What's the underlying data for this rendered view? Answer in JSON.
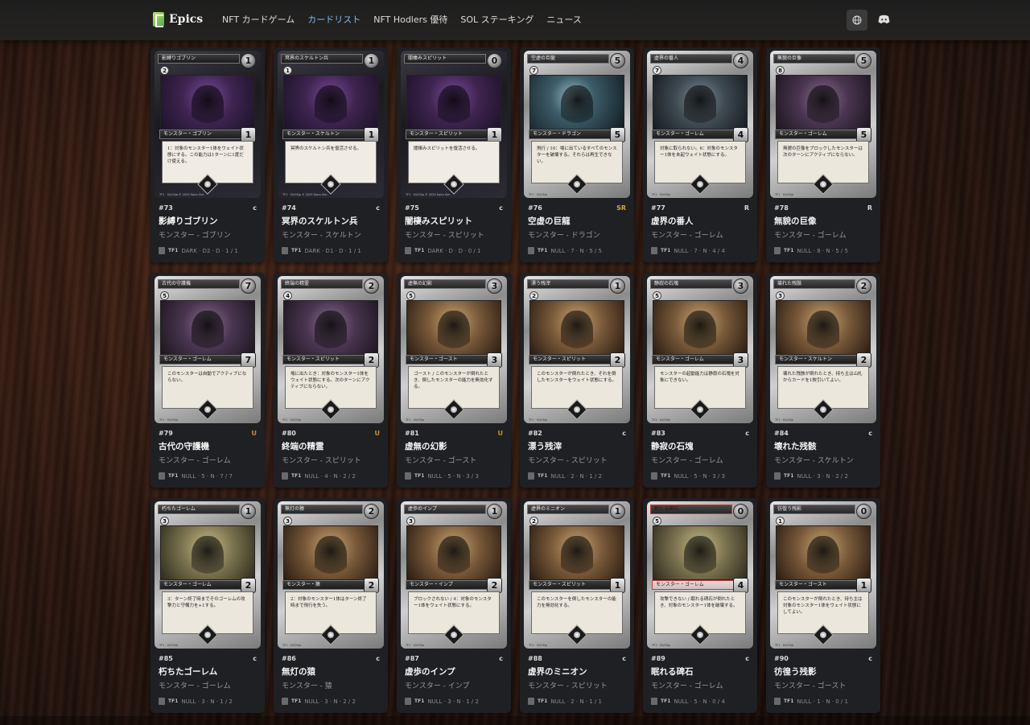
{
  "nav": {
    "brand": "Epics",
    "links": [
      "NFT カードゲーム",
      "カードリスト",
      "NFT Hodlers 優待",
      "SOL ステーキング",
      "ニュース"
    ],
    "active_index": 1
  },
  "colors": {
    "active_link": "#7fb7ef",
    "rarity_c": "#d6d6d6",
    "rarity_r": "#d6d6d6",
    "rarity_u": "#c98a2a",
    "rarity_sr": "#d6a53a"
  },
  "cards": [
    {
      "card_name": "影縛りゴブリン",
      "cost": "1",
      "level": "2",
      "type_line": "モンスター・ゴブリン",
      "power": "1",
      "text": "1：対象のモンスター1体をウェイト状態にする。この能力は1ターンに1度だけ使える。",
      "footer": "TF1 · 02/05ja   © 2025 Epics Sim",
      "num": "#73",
      "rarity": "C",
      "name": "影縛りゴブリン",
      "type": "モンスター - ゴブリン",
      "set": "TF1",
      "stats": "DARK · D2 · D · 1 / 1",
      "frame": "dark",
      "art": "purple"
    },
    {
      "card_name": "冥界のスケルトン兵",
      "cost": "1",
      "level": "1",
      "type_line": "モンスター・スケルトン",
      "power": "1",
      "text": "冥界のスケルトン兵を復活させる。",
      "footer": "TF1 · 02/05ja   © 2025 Epics Sim",
      "num": "#74",
      "rarity": "C",
      "name": "冥界のスケルトン兵",
      "type": "モンスター - スケルトン",
      "set": "TF1",
      "stats": "DARK · D1 · D · 1 / 1",
      "frame": "dark",
      "art": "purple"
    },
    {
      "card_name": "闇棲みスピリット",
      "cost": "0",
      "level": "",
      "type_line": "モンスター・スピリット",
      "power": "1",
      "text": "闇棲みスピリットを復活させる。",
      "footer": "TF1 · 02/05ja   © 2025 Epics Sim",
      "num": "#75",
      "rarity": "C",
      "name": "闇棲みスピリット",
      "type": "モンスター - スピリット",
      "set": "TF1",
      "stats": "DARK · D · D · 0 / 1",
      "frame": "dark",
      "art": "purple"
    },
    {
      "card_name": "空虚の巨龍",
      "cost": "5",
      "level": "7",
      "type_line": "モンスター・ドラゴン",
      "power": "5",
      "text": "飛行 / 10：場に出ているすべてのモンスターを破壊する。それらは再生できない。",
      "footer": "TF1 · 02/05ja",
      "num": "#76",
      "rarity": "SR",
      "name": "空虚の巨龍",
      "type": "モンスター - ドラゴン",
      "set": "TF1",
      "stats": "NULL · 7 · N · 5 / 5",
      "frame": "silver",
      "art": "teal"
    },
    {
      "card_name": "虚界の番人",
      "cost": "4",
      "level": "7",
      "type_line": "モンスター・ゴーレム",
      "power": "4",
      "text": "対象に取られない。6：対象のモンスター1体を未起ウェイト状態にする。",
      "footer": "TF1 · 02/05ja",
      "num": "#77",
      "rarity": "R",
      "name": "虚界の番人",
      "type": "モンスター - ゴーレム",
      "set": "TF1",
      "stats": "NULL · 7 · N · 4 / 4",
      "frame": "silver",
      "art": "steel"
    },
    {
      "card_name": "無貌の巨像",
      "cost": "5",
      "level": "8",
      "type_line": "モンスター・ゴーレム",
      "power": "5",
      "text": "無貌の巨像をブロックしたモンスターは次のターンにアクティブにならない。",
      "footer": "TF1 · 02/05ja",
      "num": "#78",
      "rarity": "R",
      "name": "無貌の巨像",
      "type": "モンスター - ゴーレム",
      "set": "TF1",
      "stats": "NULL · 8 · N · 5 / 5",
      "frame": "silver",
      "art": "violet"
    },
    {
      "card_name": "古代の守護機",
      "cost": "7",
      "level": "5",
      "type_line": "モンスター・ゴーレム",
      "power": "7",
      "text": "このモンスターは自動でアクティブにならない。",
      "footer": "TF1 · 02/05ja",
      "num": "#79",
      "rarity": "U",
      "name": "古代の守護機",
      "type": "モンスター - ゴーレム",
      "set": "TF1",
      "stats": "NULL · 5 · N · 7 / 7",
      "frame": "silver",
      "art": "violet"
    },
    {
      "card_name": "終端の精霊",
      "cost": "2",
      "level": "4",
      "type_line": "モンスター・スピリット",
      "power": "2",
      "text": "場に出たとき：対象のモンスター1体をウェイト状態にする。次のターンにアクティブにならない。",
      "footer": "TF1 · 02/05ja",
      "num": "#80",
      "rarity": "U",
      "name": "終端の精霊",
      "type": "モンスター - スピリット",
      "set": "TF1",
      "stats": "NULL · 4 · N · 2 / 2",
      "frame": "silver",
      "art": "violet"
    },
    {
      "card_name": "虚無の幻影",
      "cost": "3",
      "level": "5",
      "type_line": "モンスター・ゴースト",
      "power": "3",
      "text": "ゴースト / このモンスターが倒れたとき、倒したモンスターの能力を無効化する。",
      "footer": "TF1 · 02/05ja",
      "num": "#81",
      "rarity": "U",
      "name": "虚無の幻影",
      "type": "モンスター - ゴースト",
      "set": "TF1",
      "stats": "NULL · 5 · N · 3 / 3",
      "frame": "silver",
      "art": "sepia"
    },
    {
      "card_name": "漂う残滓",
      "cost": "1",
      "level": "2",
      "type_line": "モンスター・スピリット",
      "power": "2",
      "text": "このモンスターが倒れたとき、それを倒したモンスターをウェイト状態にする。",
      "footer": "TF1 · 02/05ja",
      "num": "#82",
      "rarity": "C",
      "name": "漂う残滓",
      "type": "モンスター - スピリット",
      "set": "TF1",
      "stats": "NULL · 2 · N · 1 / 2",
      "frame": "silver",
      "art": "sepia"
    },
    {
      "card_name": "静寂の石塊",
      "cost": "3",
      "level": "5",
      "type_line": "モンスター・ゴーレム",
      "power": "3",
      "text": "モンスターの起動能力は静寂の石塊を対象にできない。",
      "footer": "TF1 · 02/05ja",
      "num": "#83",
      "rarity": "C",
      "name": "静寂の石塊",
      "type": "モンスター - ゴーレム",
      "set": "TF1",
      "stats": "NULL · 5 · N · 3 / 3",
      "frame": "silver",
      "art": "sepia"
    },
    {
      "card_name": "壊れた残骸",
      "cost": "2",
      "level": "3",
      "type_line": "モンスター・スケルトン",
      "power": "2",
      "text": "壊れた残骸が倒れたとき、持ち主は山札からカードを1枚引いてよい。",
      "footer": "TF1 · 02/05ja",
      "num": "#84",
      "rarity": "C",
      "name": "壊れた残骸",
      "type": "モンスター - スケルトン",
      "set": "TF1",
      "stats": "NULL · 3 · N · 2 / 2",
      "frame": "silver",
      "art": "sepia"
    },
    {
      "card_name": "朽ちたゴーレム",
      "cost": "1",
      "level": "3",
      "type_line": "モンスター・ゴーレム",
      "power": "2",
      "text": "3：ターン終了時までそのゴーレムの攻撃力と守備力を+1する。",
      "footer": "TF1 · 02/05ja",
      "num": "#85",
      "rarity": "C",
      "name": "朽ちたゴーレム",
      "type": "モンスター - ゴーレム",
      "set": "TF1",
      "stats": "NULL · 3 · N · 1 / 2",
      "frame": "silver",
      "art": "olive"
    },
    {
      "card_name": "無灯の猿",
      "cost": "2",
      "level": "3",
      "type_line": "モンスター・猿",
      "power": "2",
      "text": "2：対象のモンスター1体はターン終了時まで飛行を失う。",
      "footer": "TF1 · 02/05ja",
      "num": "#86",
      "rarity": "C",
      "name": "無灯の猿",
      "type": "モンスター - 猿",
      "set": "TF1",
      "stats": "NULL · 3 · N · 2 / 2",
      "frame": "silver",
      "art": "sepia"
    },
    {
      "card_name": "虚歩のインプ",
      "cost": "1",
      "level": "3",
      "type_line": "モンスター・インプ",
      "power": "2",
      "text": "ブロックされない / 4：対象のモンスター1体をウェイト状態にする。",
      "footer": "TF1 · 02/05ja",
      "num": "#87",
      "rarity": "C",
      "name": "虚歩のインプ",
      "type": "モンスター - インプ",
      "set": "TF1",
      "stats": "NULL · 3 · N · 1 / 2",
      "frame": "silver",
      "art": "sepia"
    },
    {
      "card_name": "虚界のミニオン",
      "cost": "1",
      "level": "2",
      "type_line": "モンスター・スピリット",
      "power": "1",
      "text": "このモンスターを倒したモンスターの能力を無効化する。",
      "footer": "TF1 · 02/05ja",
      "num": "#88",
      "rarity": "C",
      "name": "虚界のミニオン",
      "type": "モンスター - スピリット",
      "set": "TF1",
      "stats": "NULL · 2 · N · 1 / 1",
      "frame": "silver",
      "art": "sepia"
    },
    {
      "card_name": "眠れる碑石",
      "cost": "0",
      "level": "5",
      "type_line": "モンスター・ゴーレム",
      "power": "4",
      "text": "攻撃できない / 眠れる碑石が倒れたとき、対象のモンスター1体を破壊する。",
      "footer": "TF1 · 02/05ja",
      "num": "#89",
      "rarity": "C",
      "name": "眠れる碑石",
      "type": "モンスター - ゴーレム",
      "set": "TF1",
      "stats": "NULL · 5 · N · 0 / 4",
      "frame": "silver",
      "art": "olive",
      "red": true
    },
    {
      "card_name": "彷徨う残影",
      "cost": "0",
      "level": "1",
      "type_line": "モンスター・ゴースト",
      "power": "1",
      "text": "このモンスターが倒れたとき、持ち主は対象のモンスター1体をウェイト状態にしてよい。",
      "footer": "TF1 · 02/05ja",
      "num": "#90",
      "rarity": "C",
      "name": "彷徨う残影",
      "type": "モンスター - ゴースト",
      "set": "TF1",
      "stats": "NULL · 1 · N · 0 / 1",
      "frame": "silver",
      "art": "sepia"
    }
  ]
}
